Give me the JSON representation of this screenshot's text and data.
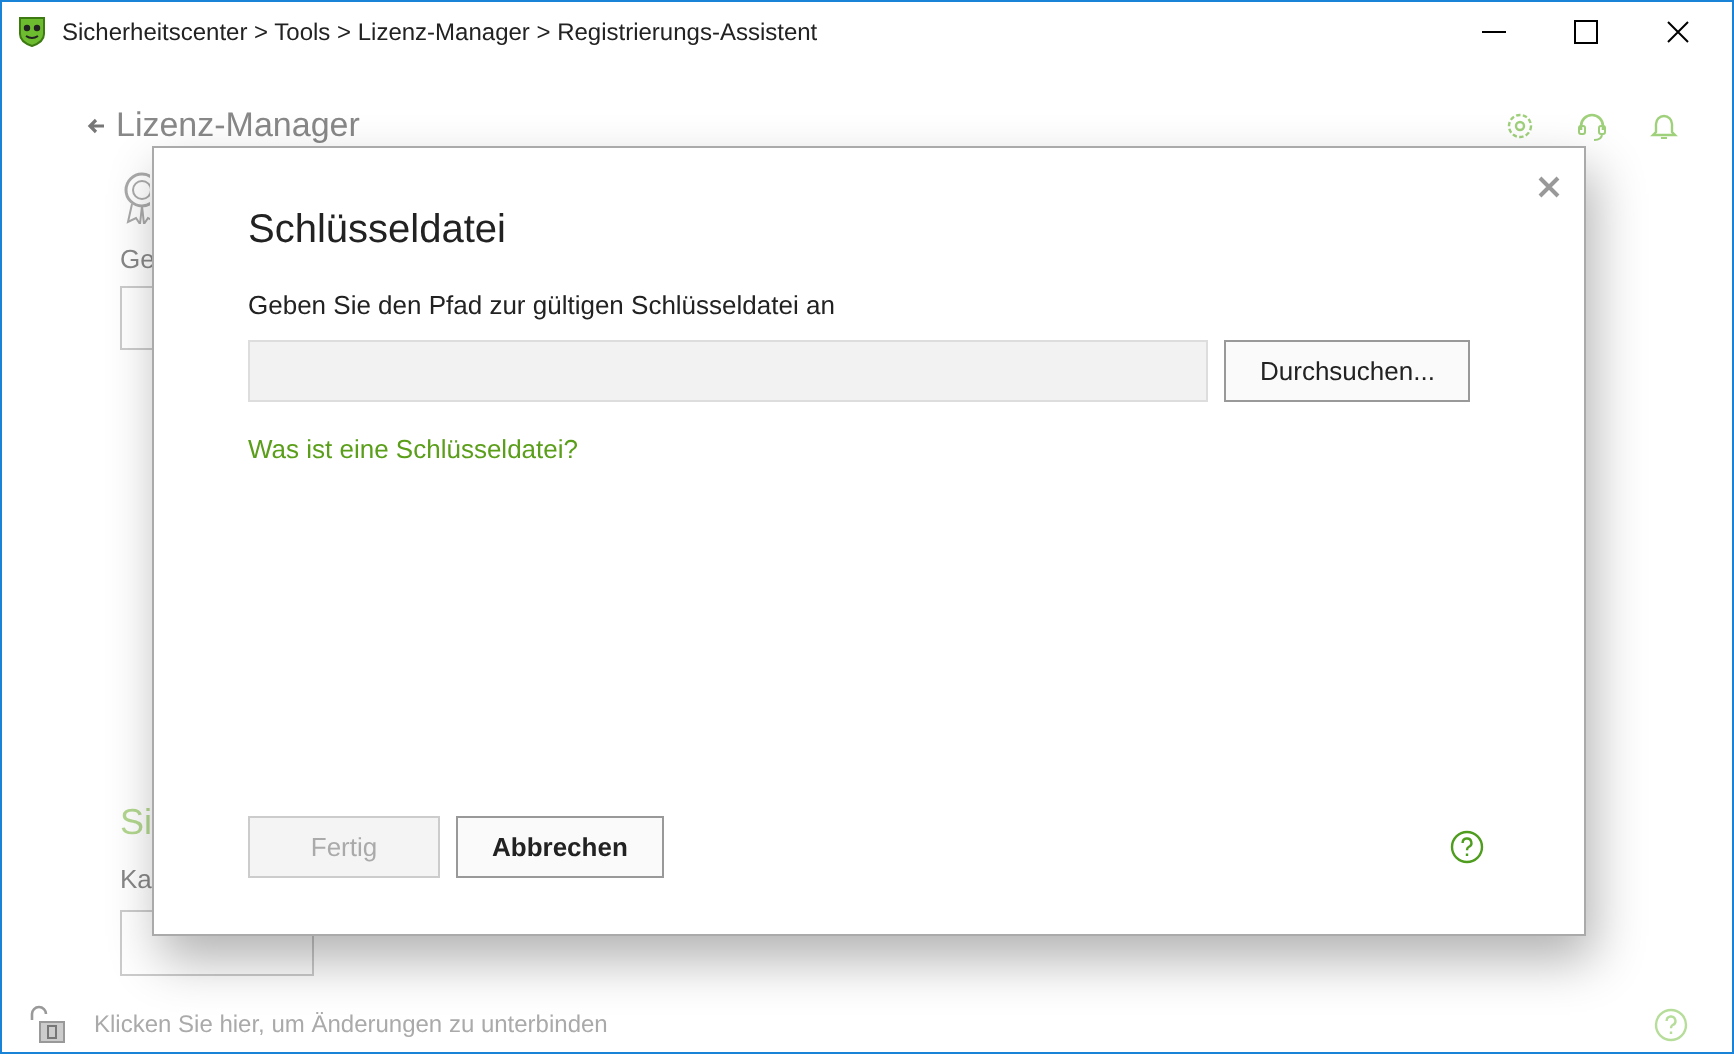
{
  "window": {
    "title": "Sicherheitscenter > Tools > Lizenz-Manager > Registrierungs-Assistent"
  },
  "header": {
    "back_label": "Lizenz-Manager"
  },
  "background": {
    "label_1": "Ge",
    "heading": "Si",
    "label_2": "Ka"
  },
  "dialog": {
    "title": "Schlüsseldatei",
    "prompt": "Geben Sie den Pfad zur gültigen Schlüsseldatei an",
    "browse_button": "Durchsuchen...",
    "link": "Was ist eine Schlüsseldatei?",
    "buttons": [
      {
        "label": "Fertig",
        "disabled": true
      },
      {
        "label": "Abbrechen",
        "disabled": false
      }
    ]
  },
  "footer": {
    "lock_text": "Klicken Sie hier, um Änderungen zu unterbinden"
  }
}
